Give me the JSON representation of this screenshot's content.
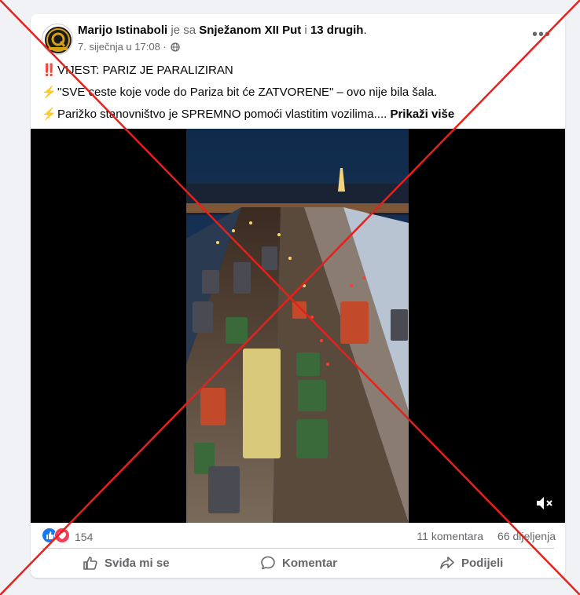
{
  "post": {
    "author": "Marijo Istinaboli",
    "with_text": "je sa",
    "tagged_person": "Snježanom XII Put",
    "and_text": "i",
    "others": "13 drugih",
    "period": ".",
    "date": "7. siječnja u 17:08",
    "separator": "·",
    "privacy_icon": "globe-icon",
    "more_label": "•••",
    "lines": [
      {
        "emoji": "‼️",
        "icon": "double-exclamation-icon",
        "text": "VIJEST: PARIZ JE PARALIZIRAN"
      },
      {
        "emoji": "⚡",
        "icon": "lightning-icon",
        "text": "\"SVE ceste koje vode do Pariza bit će ZATVORENE\" – ovo nije bila šala."
      },
      {
        "emoji": "⚡",
        "icon": "lightning-icon",
        "text": "Parižko stanovništvo je SPREMNO pomoći vlastitim vozilima...."
      }
    ],
    "see_more": "Prikaži više"
  },
  "video": {
    "muted": true,
    "mute_icon": "speaker-muted-icon"
  },
  "stats": {
    "reactions": [
      "like",
      "love"
    ],
    "reaction_count": "154",
    "comments": "11 komentara",
    "shares": "66 dijeljenja"
  },
  "actions": {
    "like": "Sviđa mi se",
    "comment": "Komentar",
    "share": "Podijeli"
  },
  "overlay": {
    "type": "red-x",
    "color": "#e8201c"
  },
  "colors": {
    "facebook_blue": "#1877f2",
    "love_red": "#f33e58",
    "muted_text": "#65676b"
  }
}
